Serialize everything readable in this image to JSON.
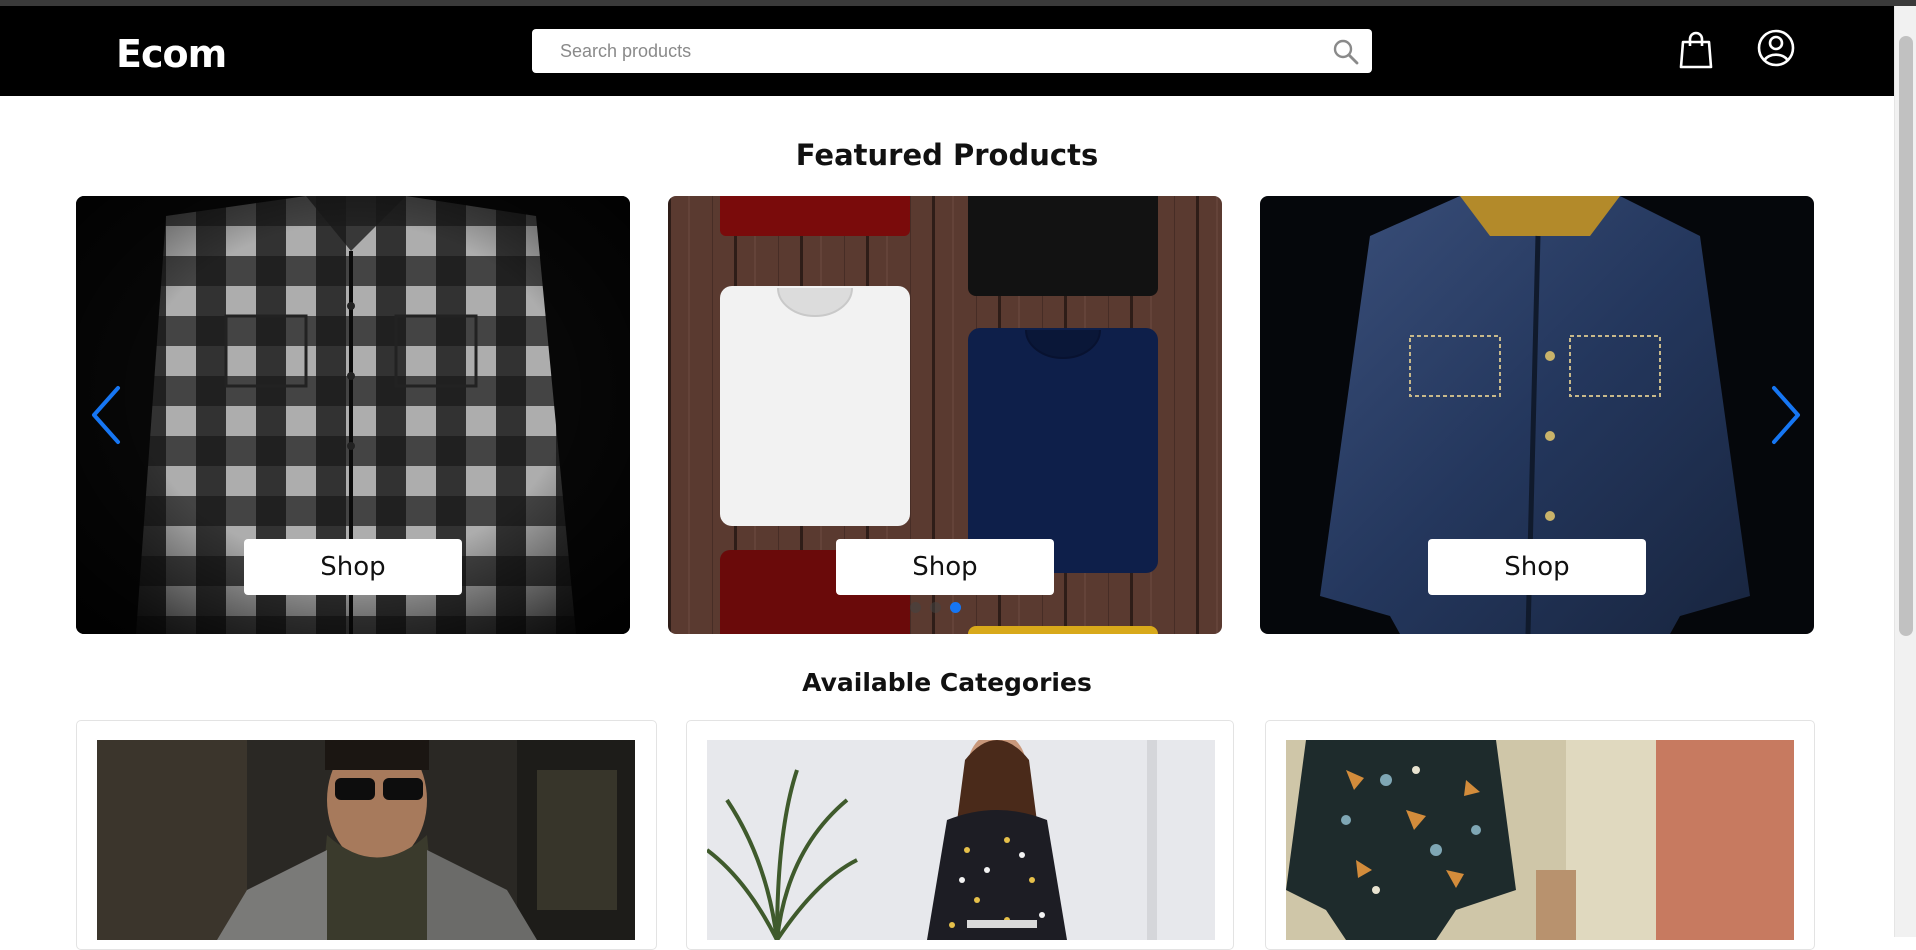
{
  "header": {
    "logo": "Ecom",
    "search_placeholder": "Search products",
    "icons": [
      "search-icon",
      "shopping-bag-icon",
      "user-account-icon"
    ]
  },
  "featured": {
    "title": "Featured Products",
    "slides": [
      {
        "product": "plaid-flannel-shirt",
        "button": "Shop"
      },
      {
        "product": "folded-t-shirts",
        "button": "Shop"
      },
      {
        "product": "denim-jacket",
        "button": "Shop"
      }
    ],
    "indicators": {
      "count": 3,
      "active_index": 2
    },
    "controls": [
      "chevron-left-icon",
      "chevron-right-icon"
    ],
    "colors": {
      "accent": "#1676f3",
      "header_bg": "#000000"
    }
  },
  "categories": {
    "title": "Available Categories",
    "cards": [
      {
        "image": "man-with-sunglasses-and-scarf"
      },
      {
        "image": "woman-in-floral-dress"
      },
      {
        "image": "boy-in-floral-shirt"
      }
    ]
  }
}
